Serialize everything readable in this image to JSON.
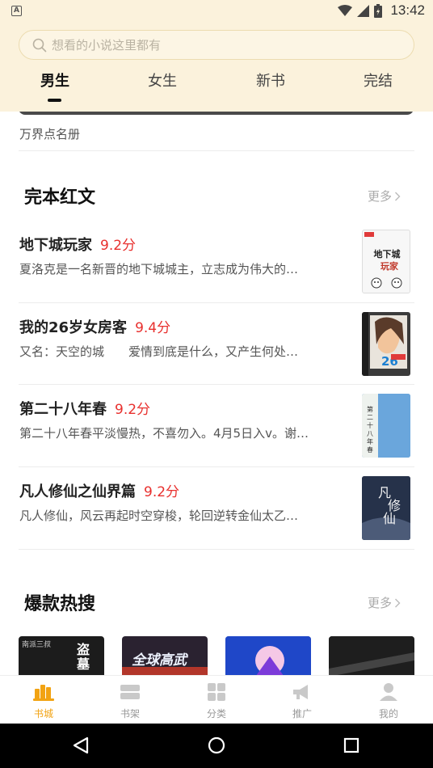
{
  "status_bar": {
    "time": "13:42",
    "left_icon": "A"
  },
  "search": {
    "placeholder": "想看的小说这里都有"
  },
  "top_tabs": [
    {
      "label": "男生",
      "active": true
    },
    {
      "label": "女生",
      "active": false
    },
    {
      "label": "新书",
      "active": false
    },
    {
      "label": "完结",
      "active": false
    }
  ],
  "banner": {
    "caption": "万界点名册"
  },
  "sections": {
    "completed": {
      "title": "完本红文",
      "more": "更多"
    },
    "hot": {
      "title": "爆款热搜",
      "more": "更多"
    }
  },
  "books": [
    {
      "title": "地下城玩家",
      "score": "9.2分",
      "desc": "夏洛克是一名新晋的地下城城主，立志成为伟大的…"
    },
    {
      "title": "我的26岁女房客",
      "score": "9.4分",
      "desc": "又名：天空的城　　爱情到底是什么，又产生何处…"
    },
    {
      "title": "第二十八年春",
      "score": "9.2分",
      "desc": "第二十八年春平淡慢热，不喜勿入。4月5日入v。谢…"
    },
    {
      "title": "凡人修仙之仙界篇",
      "score": "9.2分",
      "desc": "凡人修仙，风云再起时空穿梭，轮回逆转金仙太乙…"
    }
  ],
  "covers": {
    "book1_text": "地下城玩家",
    "book2_text": "26",
    "book3_text": "第二十八年春",
    "book4_text": "凡修仙"
  },
  "hot_covers": [
    {
      "text": "盗墓",
      "small": "南派三叔"
    },
    {
      "text": "全球高武",
      "small": ""
    },
    {
      "text": "",
      "small": ""
    },
    {
      "text": "",
      "small": ""
    }
  ],
  "bottom_tabs": [
    {
      "label": "书城",
      "icon": "store-icon",
      "active": true
    },
    {
      "label": "书架",
      "icon": "bookshelf-icon",
      "active": false
    },
    {
      "label": "分类",
      "icon": "category-icon",
      "active": false
    },
    {
      "label": "推广",
      "icon": "megaphone-icon",
      "active": false
    },
    {
      "label": "我的",
      "icon": "profile-icon",
      "active": false
    }
  ],
  "colors": {
    "accent": "#f2a313",
    "score": "#e8302e",
    "header_bg": "#fbf2dc"
  }
}
